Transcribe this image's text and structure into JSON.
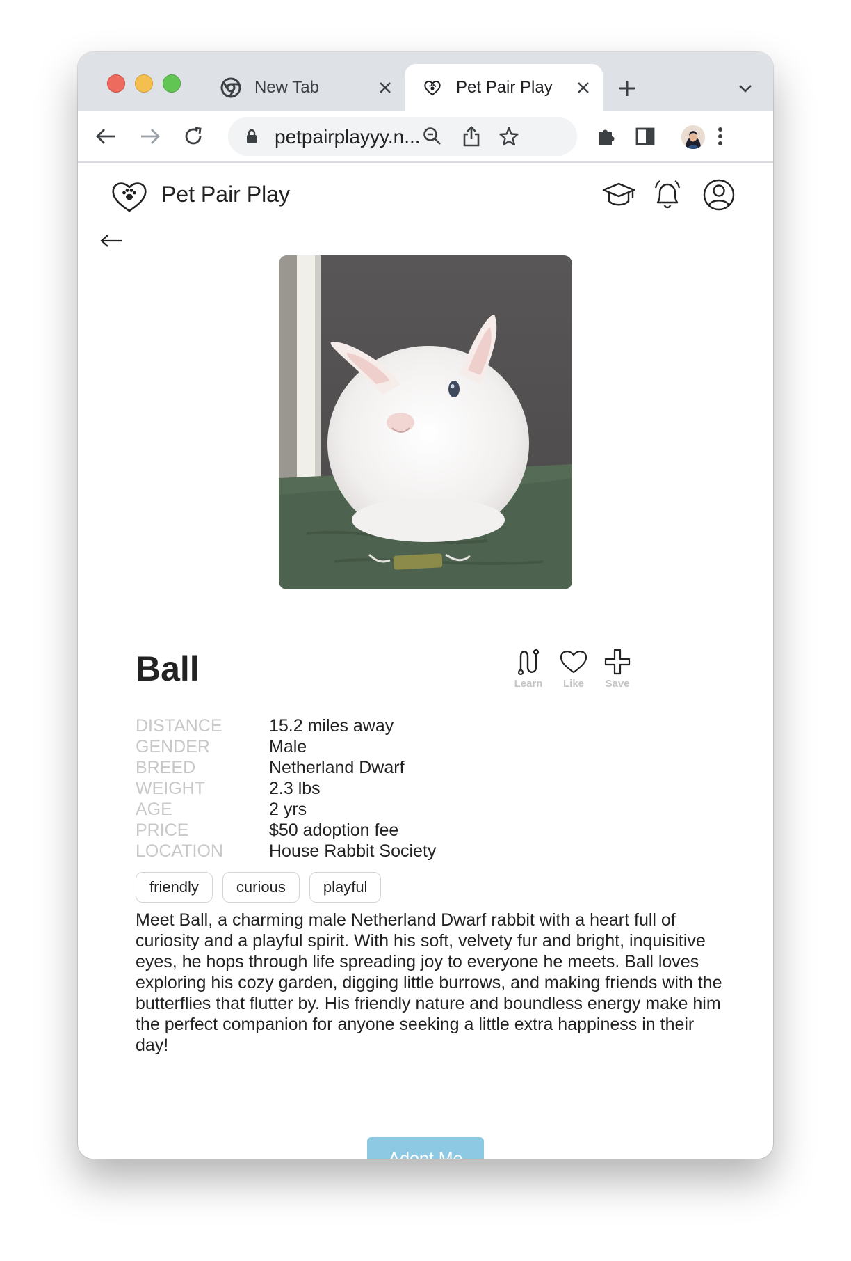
{
  "browser": {
    "tabs": [
      {
        "title": "New Tab",
        "icon": "chrome-icon",
        "active": false
      },
      {
        "title": "Pet Pair Play",
        "icon": "heart-paw-icon",
        "active": true
      }
    ],
    "url": "petpairplayyy.n...",
    "colors": {
      "tabstrip": "#dee1e6",
      "omnibox": "#f1f3f4"
    }
  },
  "site": {
    "title": "Pet Pair Play",
    "header_icons": [
      "graduation-cap-icon",
      "bell-icon",
      "user-icon"
    ]
  },
  "pet": {
    "name": "Ball",
    "actions": {
      "learn": "Learn",
      "like": "Like",
      "save": "Save"
    },
    "details": [
      {
        "label": "DISTANCE",
        "value": "15.2 miles away"
      },
      {
        "label": "GENDER",
        "value": "Male"
      },
      {
        "label": "BREED",
        "value": "Netherland Dwarf"
      },
      {
        "label": "WEIGHT",
        "value": "2.3 lbs"
      },
      {
        "label": "AGE",
        "value": "2 yrs"
      },
      {
        "label": "PRICE",
        "value": "$50 adoption fee"
      },
      {
        "label": "LOCATION",
        "value": "House Rabbit Society"
      }
    ],
    "tags": [
      "friendly",
      "curious",
      "playful"
    ],
    "description": "Meet Ball, a charming male Netherland Dwarf rabbit with a heart full of curiosity and a playful spirit. With his soft, velvety fur and bright, inquisitive eyes, he hops through life spreading joy to everyone he meets. Ball loves exploring his cozy garden, digging little burrows, and making friends with the butterflies that flutter by. His friendly nature and boundless energy make him the perfect companion for anyone seeking a little extra happiness in their day!",
    "adopt_label": "Adopt Me"
  },
  "colors": {
    "accent": "#8ec9e3",
    "label_gray": "#c8c8c8",
    "text": "#222222"
  }
}
